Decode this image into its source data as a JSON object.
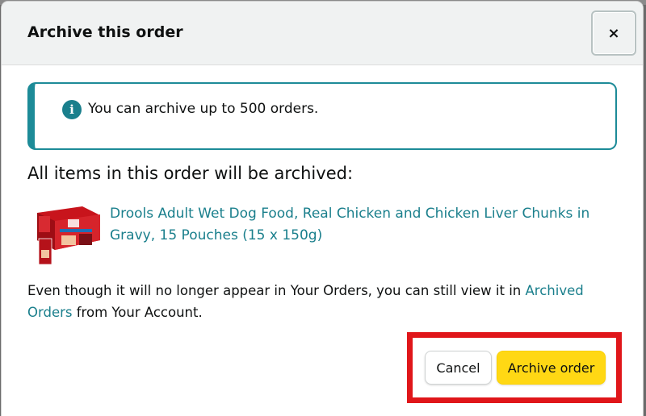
{
  "dialog": {
    "title": "Archive this order",
    "close_label": "×"
  },
  "alert": {
    "icon": "info-icon",
    "icon_glyph": "i",
    "text": "You can archive up to 500 orders."
  },
  "heading": "All items in this order will be archived:",
  "product": {
    "title_line1": "Drools Adult Wet Dog Food, Real Chicken and Chicken Liver Chunks in",
    "title_line2": "Gravy, 15 Pouches (15 x 150g)",
    "thumbnail": "dog-food-pouches-image"
  },
  "note": {
    "before_link": "Even though it will no longer appear in Your Orders, you can still view it in ",
    "link_text_line1": "Archived",
    "link_text_line2": "Orders",
    "after_link": " from Your Account."
  },
  "actions": {
    "cancel_label": "Cancel",
    "archive_label": "Archive order"
  },
  "colors": {
    "accent_teal": "#1a7f8c",
    "primary_button": "#ffd814",
    "highlight_red": "#e0161a"
  }
}
